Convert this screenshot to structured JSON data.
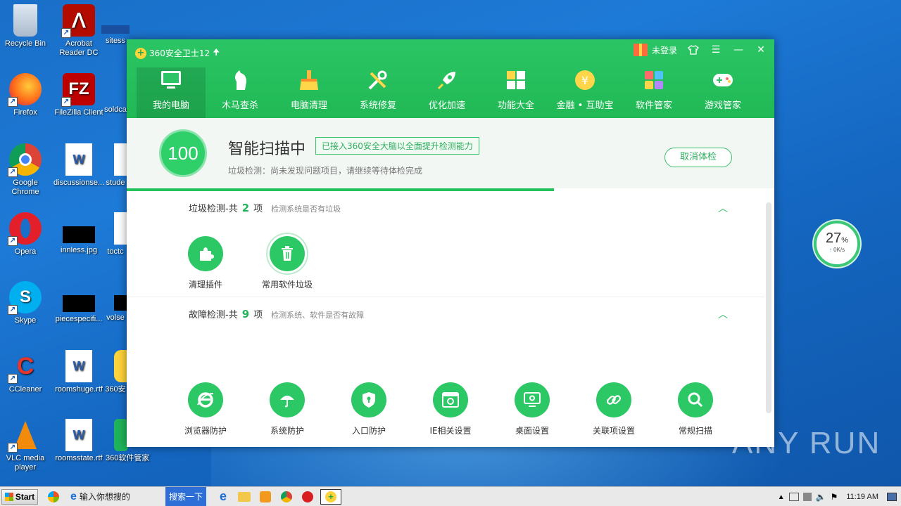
{
  "desktop": {
    "icons": [
      {
        "label": "Recycle Bin"
      },
      {
        "label": "Acrobat Reader DC"
      },
      {
        "label": "sitess"
      },
      {
        "label": "Firefox"
      },
      {
        "label": "FileZilla Client"
      },
      {
        "label": "soldca"
      },
      {
        "label": "Google Chrome"
      },
      {
        "label": "discussionse..."
      },
      {
        "label": "stude"
      },
      {
        "label": "Opera"
      },
      {
        "label": "innless.jpg"
      },
      {
        "label": "toctc"
      },
      {
        "label": "Skype"
      },
      {
        "label": "piecespecifi..."
      },
      {
        "label": "volse"
      },
      {
        "label": "CCleaner"
      },
      {
        "label": "roomshuge.rtf"
      },
      {
        "label": "360安"
      },
      {
        "label": "VLC media player"
      },
      {
        "label": "roomsstate.rtf"
      },
      {
        "label": "360软件管家"
      }
    ]
  },
  "window": {
    "title": "360安全卫士12",
    "login": "未登录",
    "nav": [
      {
        "label": "我的电脑"
      },
      {
        "label": "木马查杀"
      },
      {
        "label": "电脑清理"
      },
      {
        "label": "系统修复"
      },
      {
        "label": "优化加速"
      },
      {
        "label": "功能大全"
      },
      {
        "label": "金融 • 互助宝"
      },
      {
        "label": "软件管家"
      },
      {
        "label": "游戏管家"
      }
    ],
    "status": {
      "score": "100",
      "title": "智能扫描中",
      "tag": "已接入360安全大脑以全面提升检测能力",
      "sub": "垃圾检测：尚未发现问题项目，请继续等待体检完成",
      "cancel": "取消体检",
      "progress": 0.66
    },
    "sections": [
      {
        "title": "垃圾检测-共",
        "count": "2",
        "unit": "项",
        "desc": "检测系统是否有垃圾",
        "items": [
          {
            "label": "清理插件"
          },
          {
            "label": "常用软件垃圾"
          }
        ]
      },
      {
        "title": "故障检测-共",
        "count": "9",
        "unit": "项",
        "desc": "检测系统、软件是否有故障",
        "items": [
          {
            "label": "浏览器防护"
          },
          {
            "label": "系统防护"
          },
          {
            "label": "入口防护"
          },
          {
            "label": "IE相关设置"
          },
          {
            "label": "桌面设置"
          },
          {
            "label": "关联项设置"
          },
          {
            "label": "常规扫描"
          }
        ]
      }
    ]
  },
  "network_widget": {
    "percent": "27",
    "unit": "%",
    "speed": "0K/s"
  },
  "taskbar": {
    "start": "Start",
    "search_placeholder": "输入你想搜的",
    "search_button": "搜索一下",
    "clock": "11:19 AM"
  },
  "watermark": "ANY RUN"
}
